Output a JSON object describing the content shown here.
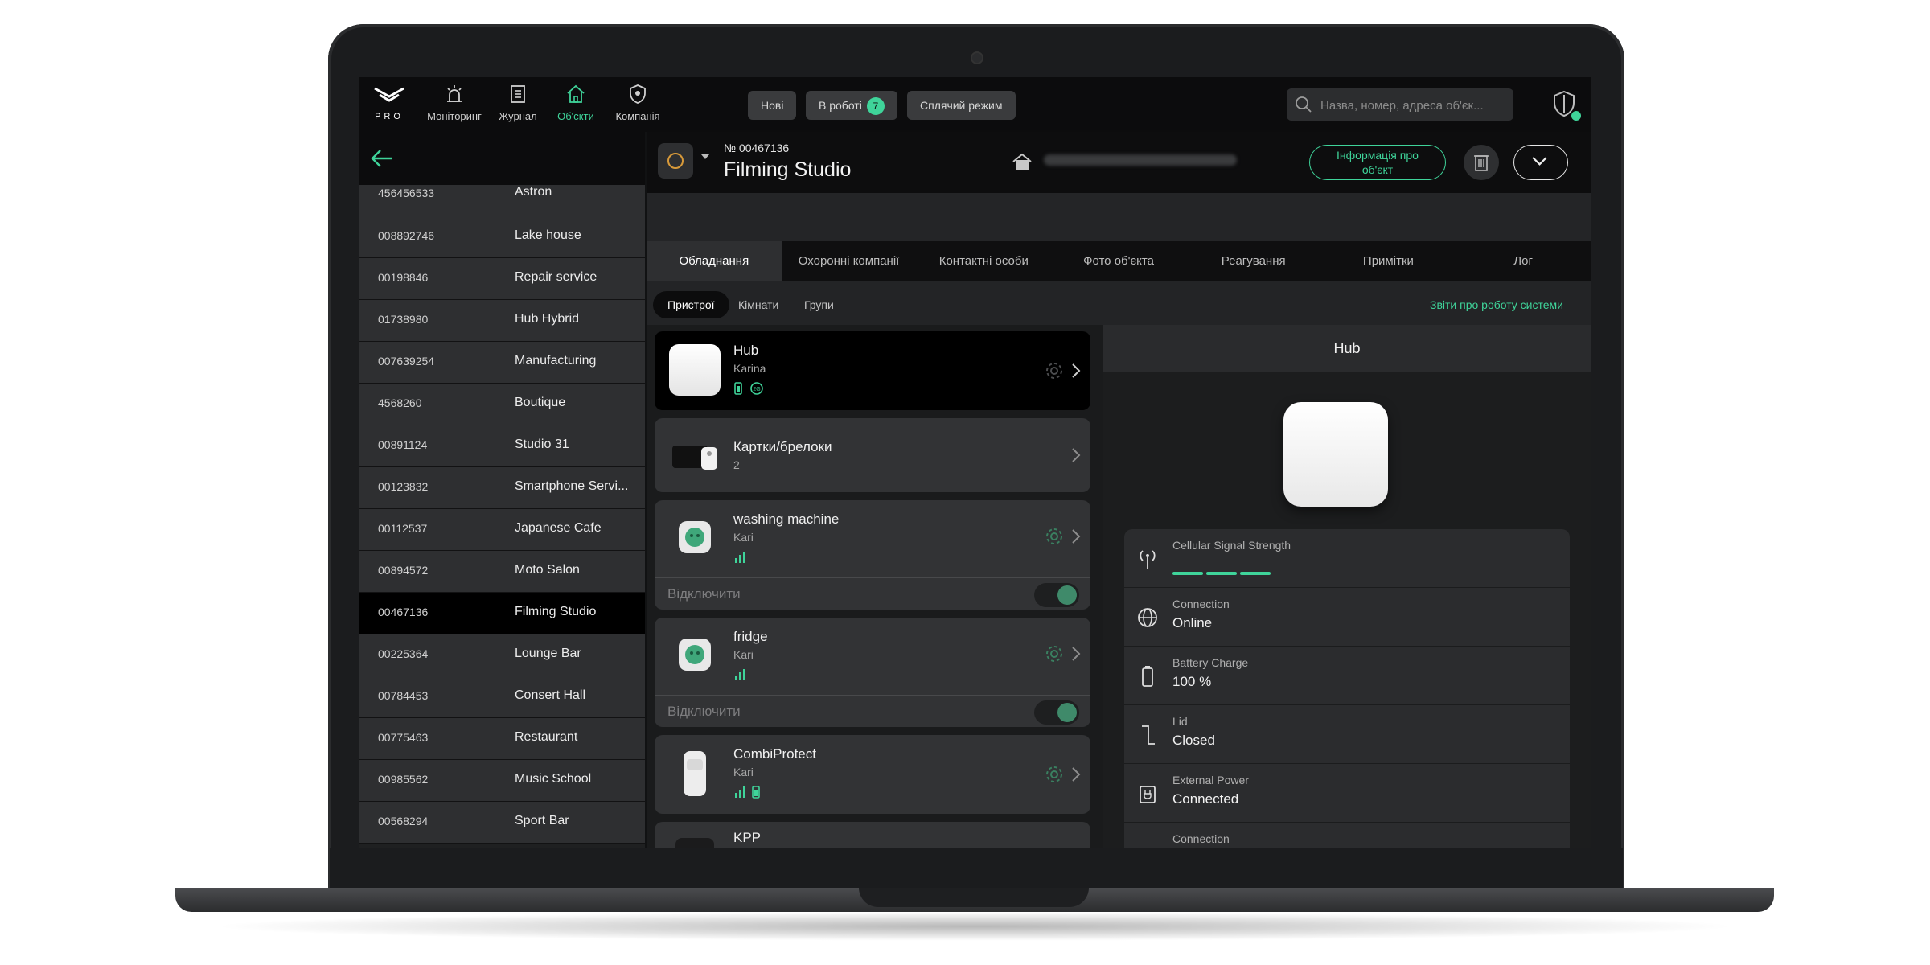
{
  "topbar": {
    "logo_text": "PRO",
    "nav": [
      {
        "label": "Моніторинг",
        "icon": "alarm-icon",
        "active": false
      },
      {
        "label": "Журнал",
        "icon": "journal-icon",
        "active": false
      },
      {
        "label": "Об'єкти",
        "icon": "home-icon",
        "active": true
      },
      {
        "label": "Компанія",
        "icon": "shield-star-icon",
        "active": false
      }
    ],
    "tabs": [
      {
        "label": "Нові"
      },
      {
        "label": "В роботі",
        "badge": "7"
      },
      {
        "label": "Сплячий режим"
      }
    ],
    "search": {
      "placeholder": "Назва, номер, адреса об'єк..."
    },
    "accent_color": "#3fd49a"
  },
  "objects": [
    {
      "num": "456456533",
      "name": "Astron"
    },
    {
      "num": "008892746",
      "name": "Lake house"
    },
    {
      "num": "00198846",
      "name": "Repair service"
    },
    {
      "num": "01738980",
      "name": "Hub Hybrid"
    },
    {
      "num": "007639254",
      "name": "Manufacturing"
    },
    {
      "num": "4568260",
      "name": "Boutique"
    },
    {
      "num": "00891124",
      "name": "Studio 31"
    },
    {
      "num": "00123832",
      "name": "Smartphone Servi..."
    },
    {
      "num": "00112537",
      "name": "Japanese Cafe"
    },
    {
      "num": "00894572",
      "name": "Moto Salon"
    },
    {
      "num": "00467136",
      "name": "Filming Studio",
      "selected": true
    },
    {
      "num": "00225364",
      "name": "Lounge Bar"
    },
    {
      "num": "00784453",
      "name": "Consert Hall"
    },
    {
      "num": "00775463",
      "name": "Restaurant"
    },
    {
      "num": "00985562",
      "name": "Music School"
    },
    {
      "num": "00568294",
      "name": "Sport Bar"
    }
  ],
  "object": {
    "number": "№ 00467136",
    "title": "Filming Studio",
    "info_button": "Інформація про об'єкт"
  },
  "tabs": [
    {
      "label": "Обладнання",
      "active": true
    },
    {
      "label": "Охоронні компанії"
    },
    {
      "label": "Контактні особи"
    },
    {
      "label": "Фото об'єкта"
    },
    {
      "label": "Реагування"
    },
    {
      "label": "Примітки"
    },
    {
      "label": "Лог"
    }
  ],
  "subtabs": [
    {
      "label": "Пристрої",
      "active": true
    },
    {
      "label": "Кімнати"
    },
    {
      "label": "Групи"
    }
  ],
  "reports_link": "Звіти про роботу системи",
  "devices": [
    {
      "title": "Hub",
      "room": "Karina"
    },
    {
      "title": "Картки/брелоки",
      "room": "2"
    },
    {
      "title": "washing machine",
      "room": "Kari",
      "disable_label": "Відключити"
    },
    {
      "title": "fridge",
      "room": "Kari",
      "disable_label": "Відключити"
    },
    {
      "title": "CombiProtect",
      "room": "Kari"
    },
    {
      "title": "KPP",
      "room": ""
    }
  ],
  "detail": {
    "title": "Hub",
    "stats": [
      {
        "key": "Cellular Signal Strength",
        "value": "",
        "icon": "antenna-icon"
      },
      {
        "key": "Connection",
        "value": "Online",
        "icon": "globe-icon"
      },
      {
        "key": "Battery Charge",
        "value": "100 %",
        "icon": "battery-icon"
      },
      {
        "key": "Lid",
        "value": "Closed",
        "icon": "lid-icon"
      },
      {
        "key": "External Power",
        "value": "Connected",
        "icon": "power-icon"
      },
      {
        "key": "Connection",
        "value": "",
        "icon": "globe-icon"
      }
    ]
  }
}
